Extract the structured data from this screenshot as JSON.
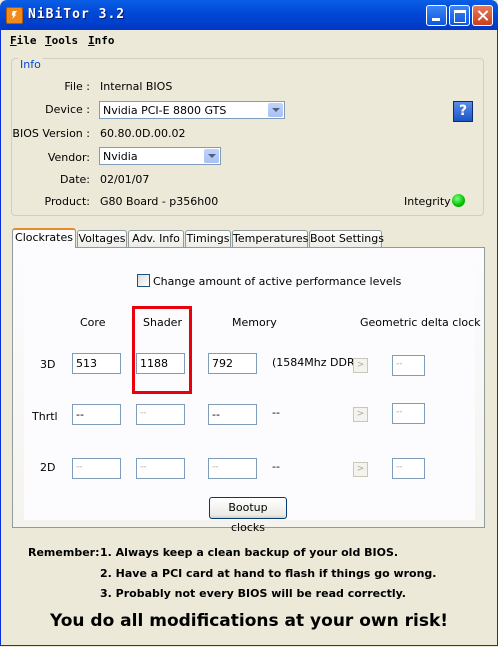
{
  "window": {
    "title": "NiBiTor 3.2"
  },
  "menu": [
    "File",
    "Tools",
    "Info"
  ],
  "info": {
    "legend": "Info",
    "file_label": "File :",
    "file_value": "Internal BIOS",
    "device_label": "Device :",
    "device_value": "Nvidia PCI-E 8800 GTS",
    "bios_version_label": "BIOS Version :",
    "bios_version_value": "60.80.0D.00.02",
    "vendor_label": "Vendor:",
    "vendor_value": "Nvidia",
    "date_label": "Date:",
    "date_value": "02/01/07",
    "product_label": "Product:",
    "product_value": "G80 Board - p356h00",
    "integrity_label": "Integrity :",
    "help_glyph": "?"
  },
  "tabs": [
    "Clockrates",
    "Voltages",
    "Adv. Info",
    "Timings",
    "Temperatures",
    "Boot Settings"
  ],
  "clockrates": {
    "checkbox_label": "Change amount of active performance levels",
    "col_core": "Core",
    "col_shader": "Shader",
    "col_memory": "Memory",
    "col_geo": "Geometric delta clock",
    "row_3d": "3D",
    "row_thrtl": "Thrtl",
    "row_2d": "2D",
    "core_3d": "513",
    "shader_3d": "1188",
    "memory_3d": "792",
    "ddr_3d": "(1584Mhz DDR)",
    "geo_3d": "--",
    "core_thrtl": "--",
    "shader_thrtl": "--",
    "memory_thrtl": "--",
    "ddr_thrtl": "--",
    "geo_thrtl": "--",
    "core_2d": "--",
    "shader_2d": "--",
    "memory_2d": "--",
    "ddr_2d": "--",
    "geo_2d": "--",
    "arrow_glyph": ">",
    "bootup_button": "Bootup clocks"
  },
  "notice": {
    "remember": "Remember:",
    "line1": "1. Always keep a clean backup of your old BIOS.",
    "line2": "2. Have a PCI card at hand to flash if things go wrong.",
    "line3": "3. Probably not every BIOS will be read correctly.",
    "warning": "You do all modifications at your own risk!"
  },
  "colors": {
    "title_bar": "#0048d6",
    "highlight": "#e8000d",
    "integrity_ok": "#00c000",
    "accent_link": "#0046d5"
  }
}
